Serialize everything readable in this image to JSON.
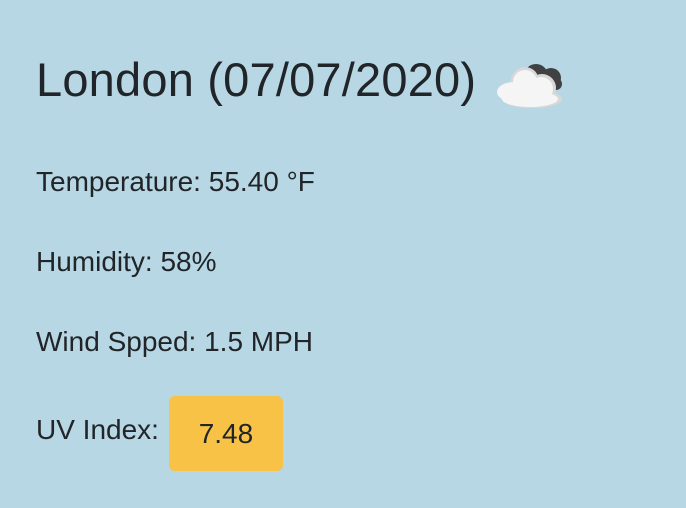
{
  "weather": {
    "title": "London (07/07/2020)",
    "icon": "cloudy-night-icon",
    "temperature": "Temperature: 55.40 °F",
    "humidity": "Humidity: 58%",
    "wind": "Wind Spped: 1.5 MPH",
    "uv_label": "UV Index:",
    "uv_value": "7.48"
  },
  "colors": {
    "background": "#b6d7e3",
    "text": "#212529",
    "uv_badge": "#f7c245",
    "cloud_light": "#f2f2f2",
    "cloud_dark": "#4a4a4a"
  }
}
